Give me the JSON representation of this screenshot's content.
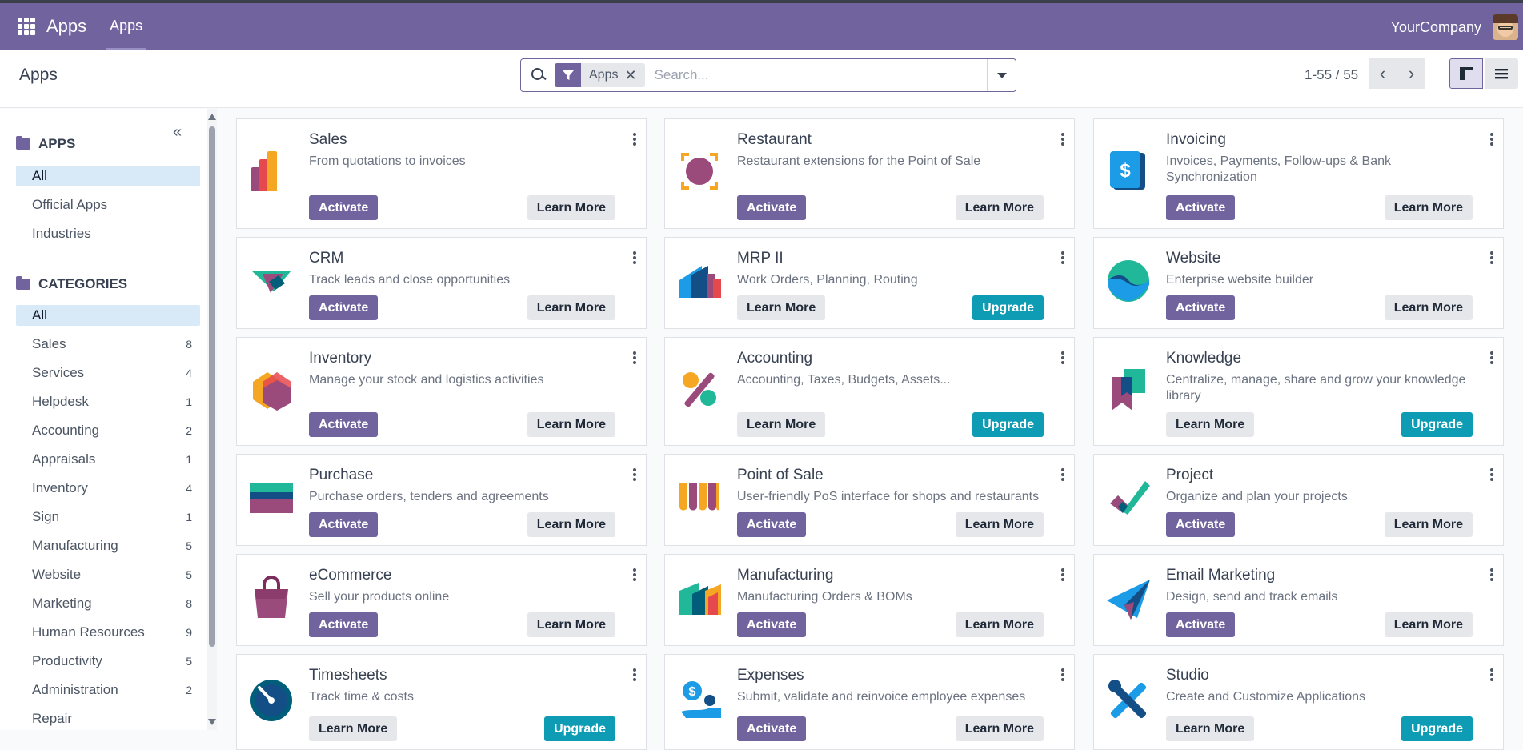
{
  "topbar": {
    "brand": "Apps",
    "menu": "Apps",
    "company": "YourCompany"
  },
  "control": {
    "title": "Apps",
    "facet_label": "Apps",
    "facet_close": "✕",
    "search_placeholder": "Search...",
    "pager": "1-55 / 55"
  },
  "sidebar": {
    "apps_heading": "APPS",
    "apps_items": [
      {
        "label": "All"
      },
      {
        "label": "Official Apps"
      },
      {
        "label": "Industries"
      }
    ],
    "categories_heading": "CATEGORIES",
    "categories": [
      {
        "label": "All",
        "count": ""
      },
      {
        "label": "Sales",
        "count": "8"
      },
      {
        "label": "Services",
        "count": "4"
      },
      {
        "label": "Helpdesk",
        "count": "1"
      },
      {
        "label": "Accounting",
        "count": "2"
      },
      {
        "label": "Appraisals",
        "count": "1"
      },
      {
        "label": "Inventory",
        "count": "4"
      },
      {
        "label": "Sign",
        "count": "1"
      },
      {
        "label": "Manufacturing",
        "count": "5"
      },
      {
        "label": "Website",
        "count": "5"
      },
      {
        "label": "Marketing",
        "count": "8"
      },
      {
        "label": "Human Resources",
        "count": "9"
      },
      {
        "label": "Productivity",
        "count": "5"
      },
      {
        "label": "Administration",
        "count": "2"
      },
      {
        "label": "Repair",
        "count": ""
      }
    ]
  },
  "labels": {
    "activate": "Activate",
    "learn_more": "Learn More",
    "upgrade": "Upgrade"
  },
  "apps": [
    {
      "name": "Sales",
      "description": "From quotations to invoices",
      "icon": "sales-icon",
      "action": "activate"
    },
    {
      "name": "Restaurant",
      "description": "Restaurant extensions for the Point of Sale",
      "icon": "restaurant-icon",
      "action": "activate"
    },
    {
      "name": "Invoicing",
      "description": "Invoices, Payments, Follow-ups & Bank Synchronization",
      "icon": "invoicing-icon",
      "action": "activate"
    },
    {
      "name": "CRM",
      "description": "Track leads and close opportunities",
      "icon": "crm-icon",
      "action": "activate"
    },
    {
      "name": "MRP II",
      "description": "Work Orders, Planning, Routing",
      "icon": "mrp-icon",
      "action": "upgrade"
    },
    {
      "name": "Website",
      "description": "Enterprise website builder",
      "icon": "website-icon",
      "action": "activate"
    },
    {
      "name": "Inventory",
      "description": "Manage your stock and logistics activities",
      "icon": "inventory-icon",
      "action": "activate"
    },
    {
      "name": "Accounting",
      "description": "Accounting, Taxes, Budgets, Assets...",
      "icon": "accounting-icon",
      "action": "upgrade"
    },
    {
      "name": "Knowledge",
      "description": "Centralize, manage, share and grow your knowledge library",
      "icon": "knowledge-icon",
      "action": "upgrade"
    },
    {
      "name": "Purchase",
      "description": "Purchase orders, tenders and agreements",
      "icon": "purchase-icon",
      "action": "activate"
    },
    {
      "name": "Point of Sale",
      "description": "User-friendly PoS interface for shops and restaurants",
      "icon": "point-of-sale-icon",
      "action": "activate"
    },
    {
      "name": "Project",
      "description": "Organize and plan your projects",
      "icon": "project-icon",
      "action": "activate"
    },
    {
      "name": "eCommerce",
      "description": "Sell your products online",
      "icon": "ecommerce-icon",
      "action": "activate"
    },
    {
      "name": "Manufacturing",
      "description": "Manufacturing Orders & BOMs",
      "icon": "manufacturing-icon",
      "action": "activate"
    },
    {
      "name": "Email Marketing",
      "description": "Design, send and track emails",
      "icon": "email-marketing-icon",
      "action": "activate"
    },
    {
      "name": "Timesheets",
      "description": "Track time & costs",
      "icon": "timesheets-icon",
      "action": "upgrade"
    },
    {
      "name": "Expenses",
      "description": "Submit, validate and reinvoice employee expenses",
      "icon": "expenses-icon",
      "action": "activate"
    },
    {
      "name": "Studio",
      "description": "Create and Customize Applications",
      "icon": "studio-icon",
      "action": "upgrade"
    }
  ],
  "colors": {
    "brand": "#71639e",
    "upgrade": "#0e9bb4",
    "active_filter": "#d8eaf8"
  }
}
